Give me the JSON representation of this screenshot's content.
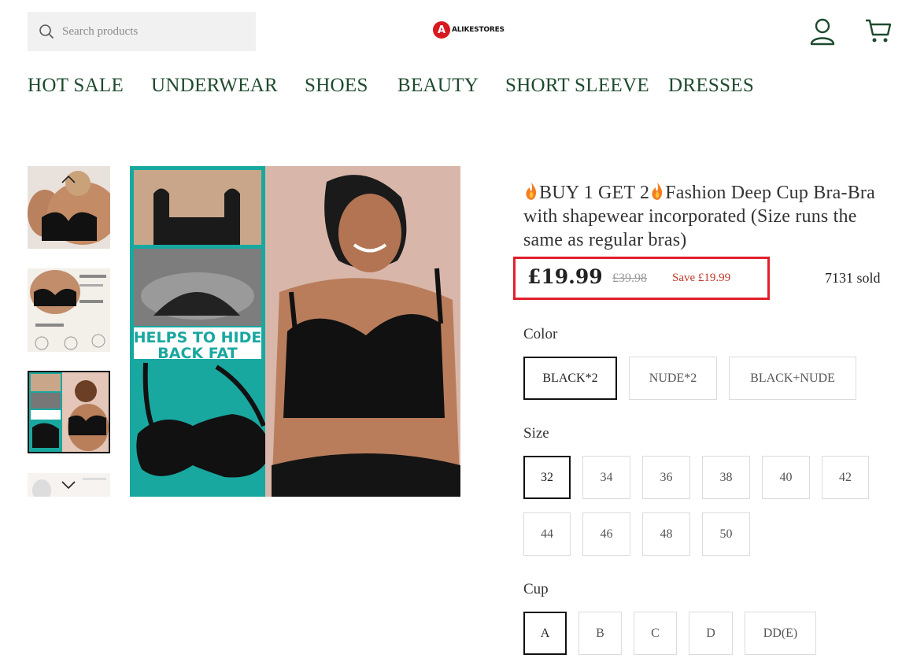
{
  "header": {
    "search_placeholder": "Search products",
    "logo_letter": "A",
    "logo_text": "ALIKESTORES"
  },
  "nav": [
    "HOT SALE",
    "UNDERWEAR",
    "SHOES",
    "BEAUTY",
    "SHORT SLEEVE",
    "DRESSES"
  ],
  "gallery": {
    "thumbnail_count": 4,
    "active_thumbnail": 3,
    "main_image_caption": "HELPS TO HIDE BACK FAT"
  },
  "product": {
    "title_part1": "BUY 1 GET 2",
    "title_part2": "Fashion Deep Cup Bra-Bra with shapewear incorporated (Size runs the same as regular bras)",
    "price": "£19.99",
    "compare_price": "£39.98",
    "save_text": "Save £19.99",
    "sold": "7131 sold"
  },
  "options": {
    "color": {
      "label": "Color",
      "values": [
        "BLACK*2",
        "NUDE*2",
        "BLACK+NUDE"
      ],
      "selected": "BLACK*2"
    },
    "size": {
      "label": "Size",
      "values": [
        "32",
        "34",
        "36",
        "38",
        "40",
        "42",
        "44",
        "46",
        "48",
        "50"
      ],
      "selected": "32"
    },
    "cup": {
      "label": "Cup",
      "values": [
        "A",
        "B",
        "C",
        "D",
        "DD(E)"
      ],
      "selected": "A"
    }
  },
  "colors": {
    "nav_green": "#1e4a2d",
    "highlight_red": "#e0202b",
    "save_red": "#c0392b",
    "teal": "#19a8a0"
  }
}
